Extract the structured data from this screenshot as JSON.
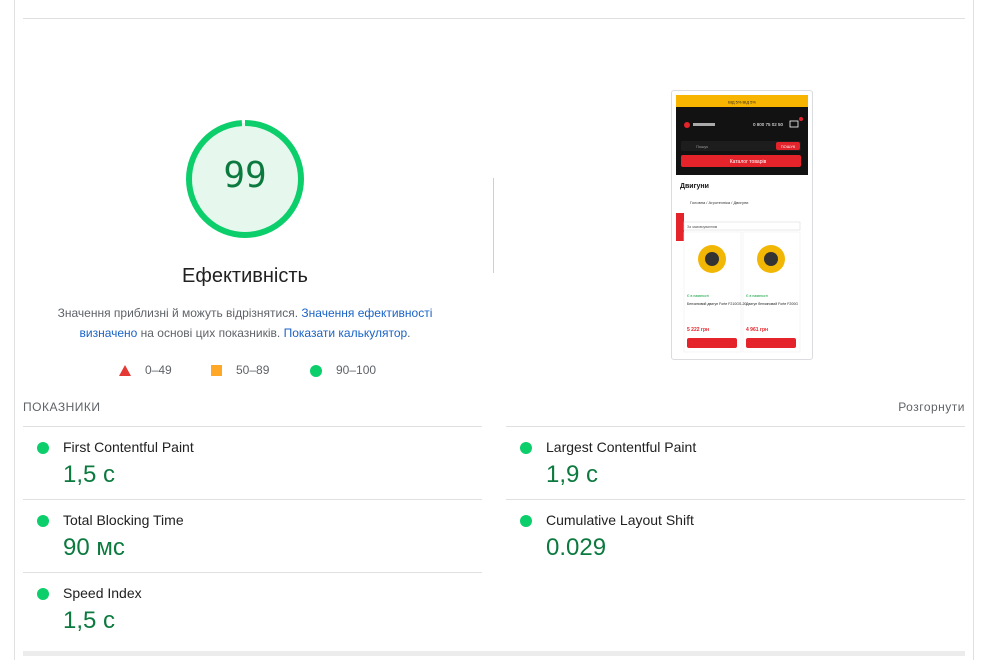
{
  "score": {
    "value": "99",
    "fraction": 0.99,
    "title": "Ефективність",
    "desc_text1": "Значення приблизні й можуть відрізнятися.",
    "desc_link1": "Значення ефективності визначено",
    "desc_text2": "на основі цих показників.",
    "desc_link2": "Показати калькулятор",
    "desc_end": "."
  },
  "legend": [
    {
      "range": "0–49",
      "color": "#e53935"
    },
    {
      "range": "50–89",
      "color": "#ffa726"
    },
    {
      "range": "90–100",
      "color": "#0cce6b"
    }
  ],
  "metrics_section": {
    "title": "ПОКАЗНИКИ",
    "expand_label": "Розгорнути"
  },
  "metrics": {
    "fcp": {
      "label": "First Contentful Paint",
      "value": "1,5 с"
    },
    "lcp": {
      "label": "Largest Contentful Paint",
      "value": "1,9 с"
    },
    "tbt": {
      "label": "Total Blocking Time",
      "value": "90 мс"
    },
    "cls": {
      "label": "Cumulative Layout Shift",
      "value": "0.029"
    },
    "si": {
      "label": "Speed Index",
      "value": "1,5 с"
    }
  },
  "screenshot": {
    "banner": "ВІД 5% ВІД 5%",
    "phone": "0 800 75 02 50",
    "search_placeholder": "Пошук",
    "search_button": "ПОШУК",
    "catalog_button": "Каталог товарів",
    "page_title": "Двигуни",
    "breadcrumb": "Головна / Агротехніка / Двигуни",
    "sort": "За замовчуванням",
    "products": [
      {
        "status": "Є в наявності",
        "name": "Бензиновий двигун Forte F210GS-20",
        "price": "5 222 грн"
      },
      {
        "status": "Є в наявності",
        "name": "Двигун бензиновий Forte F200G",
        "price": "4 961 грн"
      }
    ],
    "colors": {
      "accent": "#e5232b",
      "banner": "#f7b500",
      "header": "#121212"
    }
  }
}
